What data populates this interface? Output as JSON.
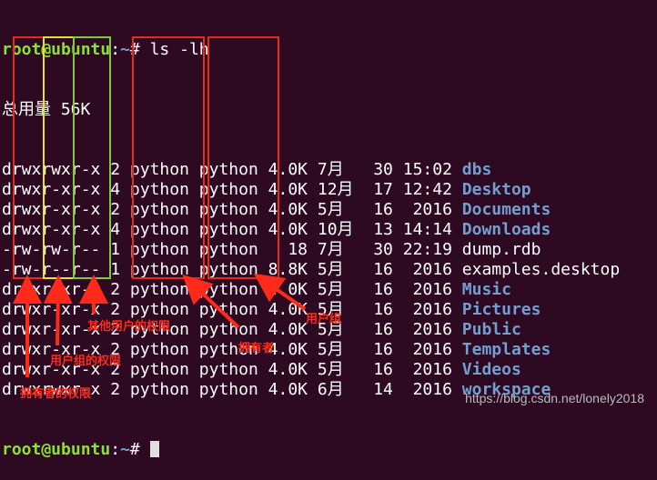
{
  "prompt": {
    "user_host": "root@ubuntu",
    "path": ":~",
    "symbol": "#"
  },
  "command": "ls -lh",
  "total_line": "总用量 56K",
  "rows": [
    {
      "perm": "drwxrwxr-x",
      "links": "2",
      "owner": "python",
      "group": "python",
      "size": "4.0K",
      "month": "7月",
      "day": "30",
      "time": "15:02",
      "name": "dbs",
      "kind": "dir"
    },
    {
      "perm": "drwxr-xr-x",
      "links": "4",
      "owner": "python",
      "group": "python",
      "size": "4.0K",
      "month": "12月",
      "day": "17",
      "time": "12:42",
      "name": "Desktop",
      "kind": "dir"
    },
    {
      "perm": "drwxr-xr-x",
      "links": "2",
      "owner": "python",
      "group": "python",
      "size": "4.0K",
      "month": "5月",
      "day": "16",
      "time": "2016",
      "name": "Documents",
      "kind": "dir"
    },
    {
      "perm": "drwxr-xr-x",
      "links": "4",
      "owner": "python",
      "group": "python",
      "size": "4.0K",
      "month": "10月",
      "day": "13",
      "time": "14:14",
      "name": "Downloads",
      "kind": "dir"
    },
    {
      "perm": "-rw-rw-r--",
      "links": "1",
      "owner": "python",
      "group": "python",
      "size": "18",
      "month": "7月",
      "day": "30",
      "time": "22:19",
      "name": "dump.rdb",
      "kind": "file"
    },
    {
      "perm": "-rw-r--r--",
      "links": "1",
      "owner": "python",
      "group": "python",
      "size": "8.8K",
      "month": "5月",
      "day": "16",
      "time": "2016",
      "name": "examples.desktop",
      "kind": "file"
    },
    {
      "perm": "drwxr-xr-x",
      "links": "2",
      "owner": "python",
      "group": "python",
      "size": "4.0K",
      "month": "5月",
      "day": "16",
      "time": "2016",
      "name": "Music",
      "kind": "dir"
    },
    {
      "perm": "drwxr-xr-x",
      "links": "2",
      "owner": "python",
      "group": "python",
      "size": "4.0K",
      "month": "5月",
      "day": "16",
      "time": "2016",
      "name": "Pictures",
      "kind": "dir"
    },
    {
      "perm": "drwxr-xr-x",
      "links": "2",
      "owner": "python",
      "group": "python",
      "size": "4.0K",
      "month": "5月",
      "day": "16",
      "time": "2016",
      "name": "Public",
      "kind": "dir"
    },
    {
      "perm": "drwxr-xr-x",
      "links": "2",
      "owner": "python",
      "group": "python",
      "size": "4.0K",
      "month": "5月",
      "day": "16",
      "time": "2016",
      "name": "Templates",
      "kind": "dir"
    },
    {
      "perm": "drwxr-xr-x",
      "links": "2",
      "owner": "python",
      "group": "python",
      "size": "4.0K",
      "month": "5月",
      "day": "16",
      "time": "2016",
      "name": "Videos",
      "kind": "dir"
    },
    {
      "perm": "drwxrwxr-x",
      "links": "2",
      "owner": "python",
      "group": "python",
      "size": "4.0K",
      "month": "6月",
      "day": "14",
      "time": "2016",
      "name": "workspace",
      "kind": "dir"
    }
  ],
  "annotations": {
    "other_perm": "其他用户的权限",
    "group_perm": "用户组的权限",
    "owner_perm": "拥有者的权限",
    "owner": "拥有者",
    "group": "用户组"
  },
  "watermark": "https://blog.csdn.net/lonely2018",
  "colors": {
    "background": "#2d0a22",
    "prompt_green": "#8ae234",
    "dir_blue": "#729fcf",
    "box_red": "#e32b1e",
    "box_yellow": "#e8e02a",
    "box_green": "#7fc93a"
  }
}
